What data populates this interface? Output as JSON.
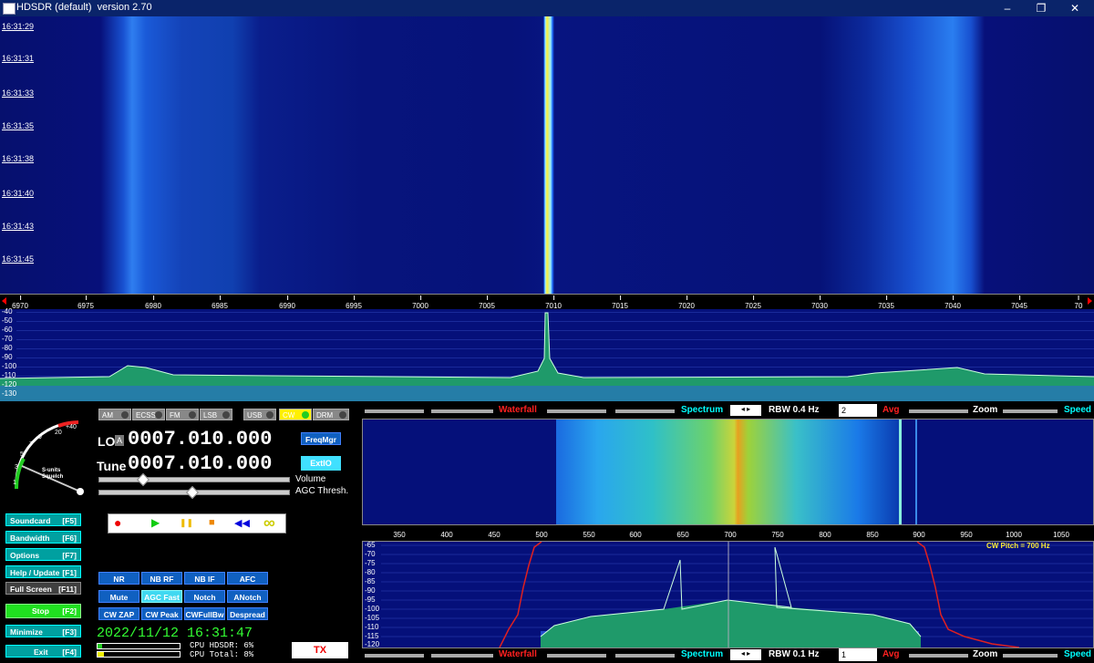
{
  "window": {
    "title": "HDSDR (default)  version 2.70",
    "minimize": "–",
    "restore": "❐",
    "close": "✕"
  },
  "waterfall": {
    "timestamps": [
      "16:31:29",
      "16:31:31",
      "16:31:33",
      "16:31:35",
      "16:31:38",
      "16:31:40",
      "16:31:43",
      "16:31:45"
    ]
  },
  "freq_scale": {
    "ticks": [
      "6970",
      "6975",
      "6980",
      "6985",
      "6990",
      "6995",
      "7000",
      "7005",
      "7010",
      "7015",
      "7020",
      "7025",
      "7030",
      "7035",
      "7040",
      "7045",
      "70"
    ]
  },
  "spectrum": {
    "db_labels": [
      "-40",
      "-50",
      "-60",
      "-70",
      "-80",
      "-90",
      "-100",
      "-110",
      "-120",
      "-130"
    ]
  },
  "smeter": {
    "label1": "S-units",
    "label2": "Squelch",
    "scale": [
      "1",
      "3",
      "5",
      "7",
      "9",
      "20",
      "+40"
    ]
  },
  "modes": [
    {
      "label": "AM",
      "active": false
    },
    {
      "label": "ECSS",
      "active": false
    },
    {
      "label": "FM",
      "active": false
    },
    {
      "label": "LSB",
      "active": false
    },
    {
      "label": "USB",
      "active": false
    },
    {
      "label": "CW",
      "active": true
    },
    {
      "label": "DRM",
      "active": false
    }
  ],
  "lo": {
    "label": "LO",
    "badge": "A",
    "value": "0007.010.000"
  },
  "tune": {
    "label": "Tune",
    "value": "0007.010.000"
  },
  "freqmgr": "FreqMgr",
  "extio": "ExtIO",
  "volume_label": "Volume",
  "agc_label": "AGC Thresh.",
  "left_buttons": [
    {
      "label": "Soundcard",
      "key": "[F5]"
    },
    {
      "label": "Bandwidth",
      "key": "[F6]"
    },
    {
      "label": "Options",
      "key": "[F7]"
    },
    {
      "label": "Help / Update",
      "key": "[F1]"
    },
    {
      "label": "Full Screen",
      "key": "[F11]"
    },
    {
      "label": "Stop",
      "key": "[F2]"
    },
    {
      "label": "Minimize",
      "key": "[F3]"
    },
    {
      "label": "Exit",
      "key": "[F4]"
    }
  ],
  "transport": {
    "record": "●",
    "play": "▶",
    "pause": "❚❚",
    "stop": "■",
    "rewind": "◀◀",
    "loop": "∞"
  },
  "dsp_buttons": [
    [
      "NR",
      "NB RF",
      "NB IF",
      "AFC"
    ],
    [
      "Mute",
      "AGC Fast",
      "Notch",
      "ANotch"
    ],
    [
      "CW ZAP",
      "CW Peak",
      "CWFullBw",
      "Despread"
    ]
  ],
  "datetime": "2022/11/12 16:31:47",
  "cpu": {
    "hdsdr": "CPU HDSDR:  6%",
    "total": "CPU Total:  8%"
  },
  "tx": "TX",
  "top_controls": {
    "waterfall": "Waterfall",
    "spectrum": "Spectrum",
    "rbw": "RBW  0.4 Hz",
    "avg_value": "2",
    "avg": "Avg",
    "zoom": "Zoom",
    "speed": "Speed"
  },
  "bottom_controls": {
    "waterfall": "Waterfall",
    "spectrum": "Spectrum",
    "rbw": "RBW  0.1 Hz",
    "avg_value": "1",
    "avg": "Avg",
    "zoom": "Zoom",
    "speed": "Speed"
  },
  "zoom_scale": {
    "ticks": [
      "350",
      "400",
      "450",
      "500",
      "550",
      "600",
      "650",
      "700",
      "750",
      "800",
      "850",
      "900",
      "950",
      "1000",
      "1050"
    ]
  },
  "zoom_spectrum": {
    "db_labels": [
      "-65",
      "-70",
      "-75",
      "-80",
      "-85",
      "-90",
      "-95",
      "-100",
      "-105",
      "-110",
      "-115",
      "-120"
    ],
    "cw_pitch": "CW Pitch = 700 Hz"
  },
  "colors": {
    "cyan": "#00ffff",
    "waterfall_red": "#ff2020",
    "teal_button": "#00a0a0",
    "dsp_blue": "#1060c0",
    "green_text": "#33ff33"
  }
}
